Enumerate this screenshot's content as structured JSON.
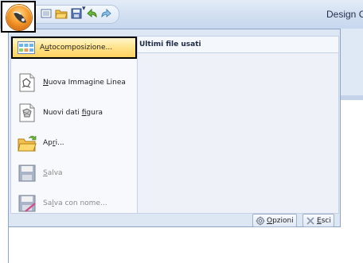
{
  "titlebar": {
    "app_title": "Design C",
    "quick_access": {
      "dropdown_glyph": "▾",
      "icons": [
        "new-document-icon",
        "open-folder-icon",
        "save-icon",
        "undo-icon",
        "redo-icon"
      ]
    }
  },
  "app_button": {
    "icon": "application-orb-icon"
  },
  "menu": {
    "items": [
      {
        "pre": "A",
        "u": "u",
        "post": "tocomposizione...",
        "icon": "auto-compose-icon",
        "selected": true
      },
      {
        "pre": "",
        "u": "N",
        "post": "uova Immagine Linea",
        "icon": "new-line-image-icon"
      },
      {
        "pre": "Nuovi dati ",
        "u": "f",
        "post": "igura",
        "icon": "new-pattern-data-icon"
      },
      {
        "pre": "Ap",
        "u": "r",
        "post": "i...",
        "icon": "open-folder-icon"
      },
      {
        "pre": "",
        "u": "S",
        "post": "alva",
        "icon": "save-icon",
        "disabled": true
      },
      {
        "pre": "Sa",
        "u": "l",
        "post": "va con nome...",
        "icon": "save-as-icon",
        "disabled": true
      }
    ],
    "recent_files_title": "Ultimi file usati",
    "footer": {
      "options": {
        "pre": "",
        "u": "O",
        "post": "pzioni",
        "icon": "options-icon"
      },
      "exit": {
        "pre": "",
        "u": "E",
        "post": "sci",
        "icon": "exit-icon"
      }
    }
  }
}
